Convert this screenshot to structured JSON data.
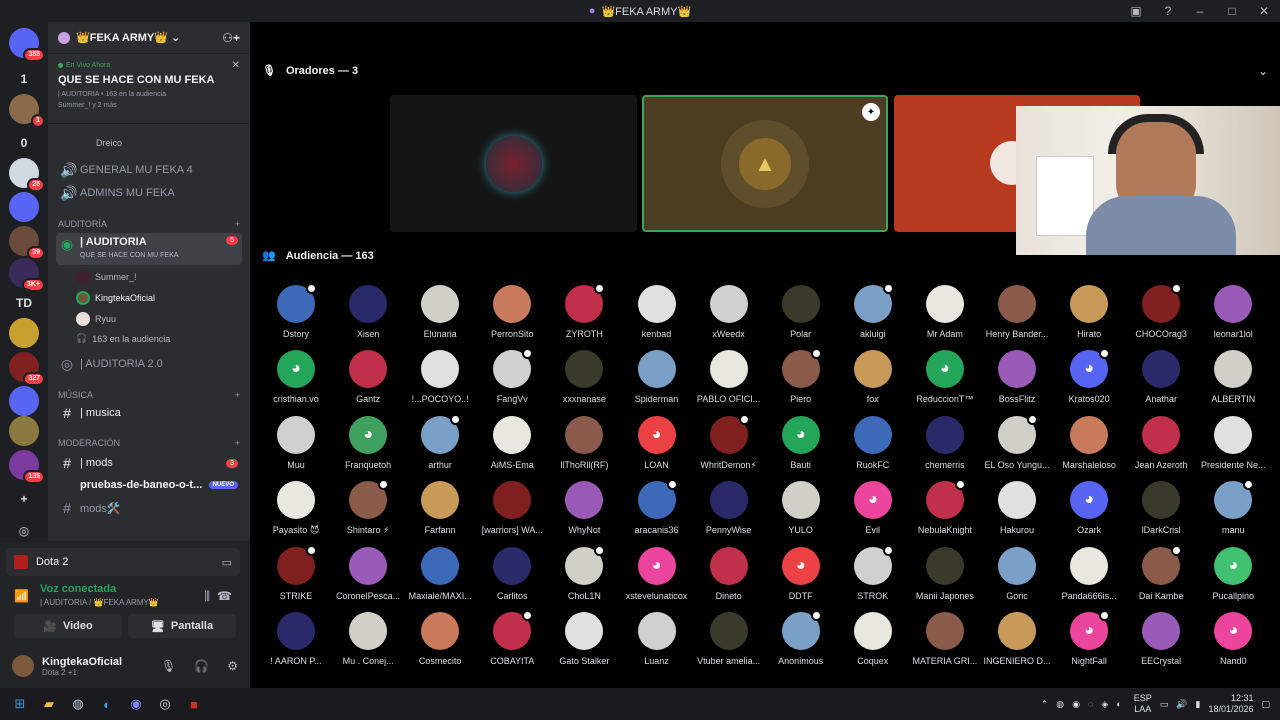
{
  "window": {
    "title": "👑FEKA ARMY👑"
  },
  "guilds": [
    {
      "label": "",
      "badge": "355"
    },
    {
      "label": "1",
      "badge": ""
    },
    {
      "label": "",
      "badge": "1"
    },
    {
      "label": "0",
      "badge": ""
    },
    {
      "label": "",
      "badge": "25"
    },
    {
      "label": "",
      "badge": ""
    },
    {
      "label": "",
      "badge": "39"
    },
    {
      "label": "",
      "badge": "3K+"
    },
    {
      "label": "TD",
      "badge": ""
    },
    {
      "label": "",
      "badge": ""
    },
    {
      "label": "",
      "badge": "327"
    },
    {
      "label": "",
      "badge": ""
    },
    {
      "label": "",
      "badge": ""
    },
    {
      "label": "",
      "badge": "135"
    }
  ],
  "server": {
    "name": "👑FEKA ARMY👑"
  },
  "live": {
    "status": "En Vivo Ahora",
    "title": "QUE SE HACE CON MU FEKA",
    "meta": "| AUDITORIA • 163 en la audiencia",
    "users": "Summer_! y 2 más"
  },
  "channels": {
    "dreico": "Dreico",
    "general": "GENERAL MU FEKA 4",
    "admins": "ADMINS MU FEKA",
    "cat_auditoria": "AUDITORÍA",
    "auditoria": "| AUDITORIA",
    "auditoria_badge": "5",
    "auditoria_sub": "QUE SE HACE CON MU FEKA",
    "summer": "Summer_!",
    "kingteka": "KingtekaOficial",
    "ryuu": "Ryuu",
    "aud_count": "163 en la audiencia",
    "auditoria2": "| AUDITORIA 2.0",
    "cat_musica": "MÚSICA",
    "musica": "| musica",
    "cat_moderacion": "MODERACIÓN",
    "mods": "| mods",
    "mods_badge": "3",
    "pruebas": "pruebas-de-baneo-o-t...",
    "nuevo": "NUEVO",
    "mods2": "mods🛠️"
  },
  "panel": {
    "game": "Dota 2",
    "voice_status": "Voz conectada",
    "voice_where": "| AUDITORIA / 👑FEKA ARMY👑",
    "video": "Video",
    "screen": "Pantalla",
    "user": "KingtekaOficial",
    "user_status": "Dota 2 +1"
  },
  "stage": {
    "speakers_label": "Oradores — 3",
    "audience_label": "Audiencia — 163"
  },
  "audience": [
    [
      "Dstory",
      "Xisen",
      "Elunaria",
      "PerronSito",
      "ZYROTH",
      "kenbad",
      "xWeedx",
      "Polar",
      "akluigi",
      "Mr Adam",
      "Henry Bander...",
      "Hirato",
      "CHOCOrag3",
      "leonar1lol"
    ],
    [
      "cristhian.vo",
      "Gantz",
      "!...POCOYO..!",
      "FangVv",
      "xxxnanase",
      "Spiderman",
      "PABLO OFICI...",
      "Piero",
      "fox",
      "ReduccionT™",
      "BossFlitz",
      "Kratos020",
      "Anathar",
      "ALBERTIN"
    ],
    [
      "Muu",
      "Franquetoh",
      "arthur",
      "AiMS-Ema",
      "llThoRll(RF)",
      "LOAN",
      "WhritDemon⚡",
      "Bauti",
      "RuokFC",
      "chemerris",
      "EL Oso Yungu...",
      "Marshaleloso",
      "Jean Azeroth",
      "Presidente Ne..."
    ],
    [
      "Payasito 😈",
      "Shintaro ⚡",
      "Farfann",
      "[warriors] WA...",
      "WhyNot",
      "aracanis36",
      "PennyWise",
      "YULO",
      "Evil",
      "NebulaKnight",
      "Hakurou",
      "Ozark",
      "lDarkCrisl",
      "manu"
    ],
    [
      "STRIKE",
      "CoronelPesca...",
      "Maxiale/MAXI...",
      "Carlitos",
      "ChoL1N",
      "xstevelunaticox",
      "Dineto",
      "DDTF",
      "STROK",
      "Manii Japones",
      "Goric",
      "Panda666is...",
      "Dai Kambe",
      "Pucallpino"
    ],
    [
      "! AARON P...",
      "Mu . Conej...",
      "Cosmecito",
      "COBAYITA",
      "Gato Stalker",
      "Luanz",
      "Vtuber amelia...",
      "Anonimous",
      "Coquex",
      "MATERIA GRI...",
      "INGENIERO D...",
      "NightFall",
      "EECrystal",
      "Nand0"
    ]
  ],
  "taskbar": {
    "lang1": "ESP",
    "lang2": "LAA",
    "time": "12:31",
    "date": "18/01/2026"
  }
}
